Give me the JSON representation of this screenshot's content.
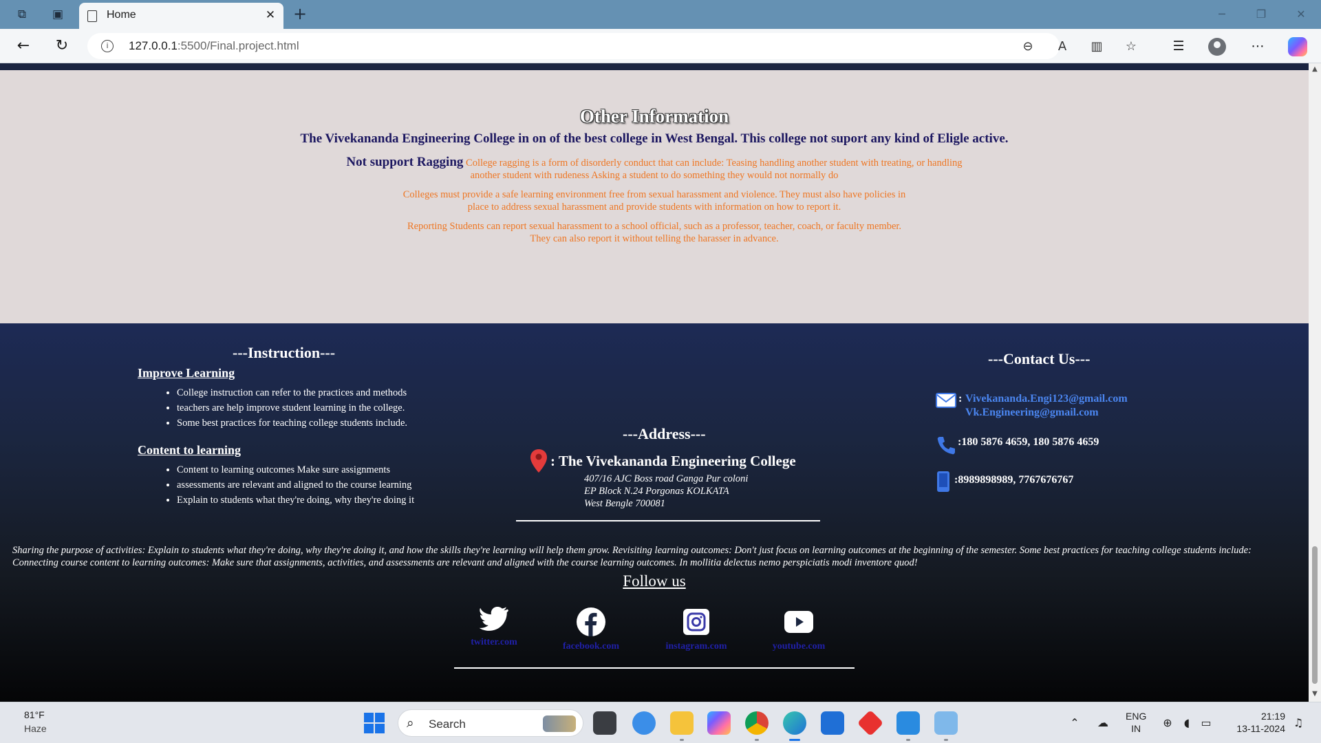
{
  "browser": {
    "tab_title": "Home",
    "url_host": "127.0.0.1",
    "url_path": ":5500/Final.project.html"
  },
  "other_info": {
    "title": "Other Information",
    "lead": "The Vivekananda Engineering College in on of the best college in West Bengal. This college not suport any kind of Eligle active.",
    "ragging_heading": "Not support Ragging",
    "ragging_text": "College ragging is a form of disorderly conduct that can include: Teasing handling another student with treating, or handling another student with rudeness Asking a student to do something they would not normally do",
    "harassment_text": "Colleges must provide a safe learning environment free from sexual harassment and violence. They must also have policies in place to address sexual harassment and provide students with information on how to report it.",
    "reporting_text": "Reporting Students can report sexual harassment to a school official, such as a professor, teacher, coach, or faculty member. They can also report it without telling the harasser in advance."
  },
  "instruction": {
    "title": "---Instruction---",
    "improve_heading": "Improve Learning",
    "improve_items": [
      "College instruction can refer to the practices and methods",
      "teachers are help improve student learning in the college.",
      "Some best practices for teaching college students include."
    ],
    "content_heading": "Content to learning",
    "content_items": [
      "Content to learning outcomes Make sure assignments",
      "assessments are relevant and aligned to the course learning",
      "Explain to students what they're doing, why they're doing it"
    ]
  },
  "address": {
    "title": "---Address---",
    "name": ": The Vivekananda Engineering College",
    "lines": [
      "407/16 AJC Boss road Ganga Pur coloni",
      "EP Block N.24 Porgonas KOLKATA",
      "West Bengle 700081"
    ]
  },
  "contact": {
    "title": "---Contact Us---",
    "email_prefix": ":",
    "email_1": "Vivekananda.Engi123@gmail.com",
    "email_2": "Vk.Engineering@gmail.com",
    "phone": ":180 5876 4659, 180 5876 4659",
    "mobile": ":8989898989, 7767676767"
  },
  "sharing_text": "Sharing the purpose of activities: Explain to students what they're doing, why they're doing it, and how the skills they're learning will help them grow. Revisiting learning outcomes: Don't just focus on learning outcomes at the beginning of the semester. Some best practices for teaching college students include: Connecting course content to learning outcomes: Make sure that assignments, activities, and assessments are relevant and aligned with the course learning outcomes. In mollitia delectus nemo perspiciatis modi inventore quod!",
  "follow": {
    "title": "Follow us",
    "links": [
      "twitter.com",
      "facebook.com",
      "instagram.com",
      "youtube.com"
    ]
  },
  "taskbar": {
    "weather_temp": "81°F",
    "weather_desc": "Haze",
    "search_label": "Search",
    "lang_1": "ENG",
    "lang_2": "IN",
    "time": "21:19",
    "date": "13-11-2024"
  },
  "colors": {
    "tab_strip": "#6591b3",
    "info_bg": "#e0d9d9",
    "heading_navy": "#1c1760",
    "body_orange": "#ee7623",
    "footer_top": "#1d2a55",
    "email_link": "#4b86f0",
    "social_link": "#2020a8"
  }
}
